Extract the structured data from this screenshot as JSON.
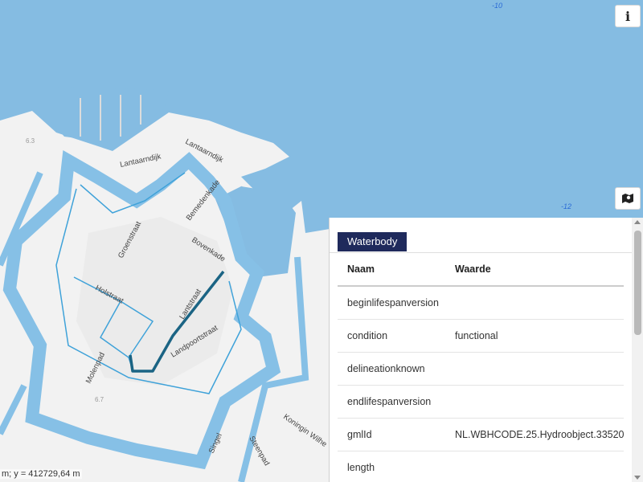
{
  "map": {
    "streets": [
      "Lantaarndijk",
      "Lantaarndijk",
      "Groenstraat",
      "Bemedenkade",
      "Bovenkade",
      "Holstraat",
      "Lantstraat",
      "Landpoortstraat",
      "Molenpad",
      "Koningin Wilhe",
      "Steenpad",
      "Singel"
    ],
    "spot_heights": [
      "6.3",
      "6.7"
    ],
    "depth_labels": [
      "-10",
      "-12"
    ],
    "coordinate_readout": "m; y = 412729,64 m",
    "colors": {
      "water": "#85bce2",
      "land": "#f3f3f3",
      "canal": "#86c0e6",
      "selection": "#1b6484"
    }
  },
  "controls": {
    "info_label": "i",
    "layers_icon": "map-layers-icon"
  },
  "panel": {
    "tab": "Waterbody",
    "header": {
      "key": "Naam",
      "value": "Waarde"
    },
    "rows": [
      {
        "key": "beginlifespanversion",
        "value": ""
      },
      {
        "key": "condition",
        "value": "functional"
      },
      {
        "key": "delineationknown",
        "value": ""
      },
      {
        "key": "endlifespanversion",
        "value": ""
      },
      {
        "key": "gmlId",
        "value": "NL.WBHCODE.25.Hydroobject.33520"
      },
      {
        "key": "length",
        "value": ""
      }
    ]
  }
}
